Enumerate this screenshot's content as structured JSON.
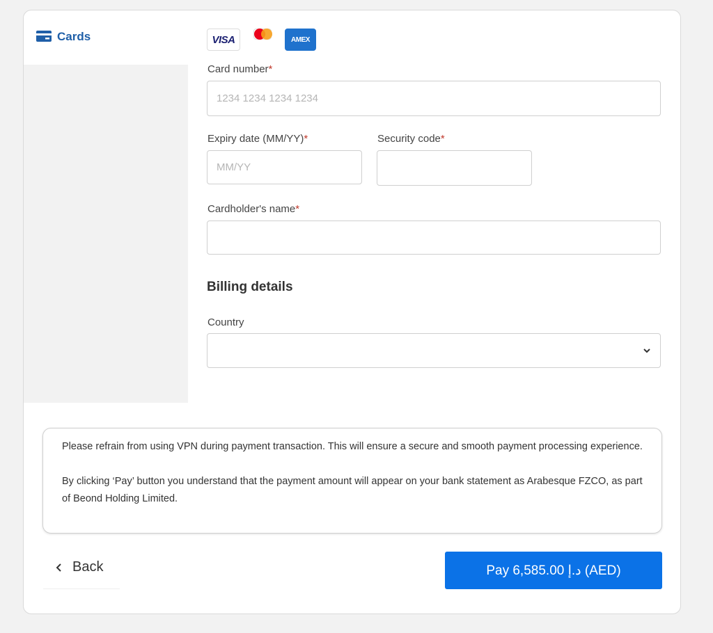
{
  "side": {
    "tab_label": "Cards"
  },
  "brands": {
    "visa": "VISA",
    "amex": "AMEX"
  },
  "card_number": {
    "label": "Card number",
    "required": "*",
    "placeholder": "1234 1234 1234 1234",
    "value": ""
  },
  "expiry": {
    "label": "Expiry date (MM/YY)",
    "required": "*",
    "placeholder": "MM/YY",
    "value": ""
  },
  "security": {
    "label": "Security code",
    "required": "*",
    "placeholder": "",
    "value": ""
  },
  "cardholder": {
    "label": "Cardholder's name",
    "required": "*",
    "placeholder": "",
    "value": ""
  },
  "billing": {
    "title": "Billing details",
    "country_label": "Country",
    "country_value": ""
  },
  "notice": {
    "line1": "Please refrain from using VPN during payment transaction. This will ensure a secure and smooth payment processing experience.",
    "line2": "By clicking ‘Pay’ button you understand that the payment amount will appear on your bank statement as Arabesque FZCO, as part of Beond Holding Limited."
  },
  "actions": {
    "back_label": "Back",
    "pay_label": "Pay 6,585.00 د.إ (AED)"
  },
  "colors": {
    "primary": "#0b72e7",
    "tab_accent": "#1f5fa8",
    "required": "#c0392b"
  }
}
